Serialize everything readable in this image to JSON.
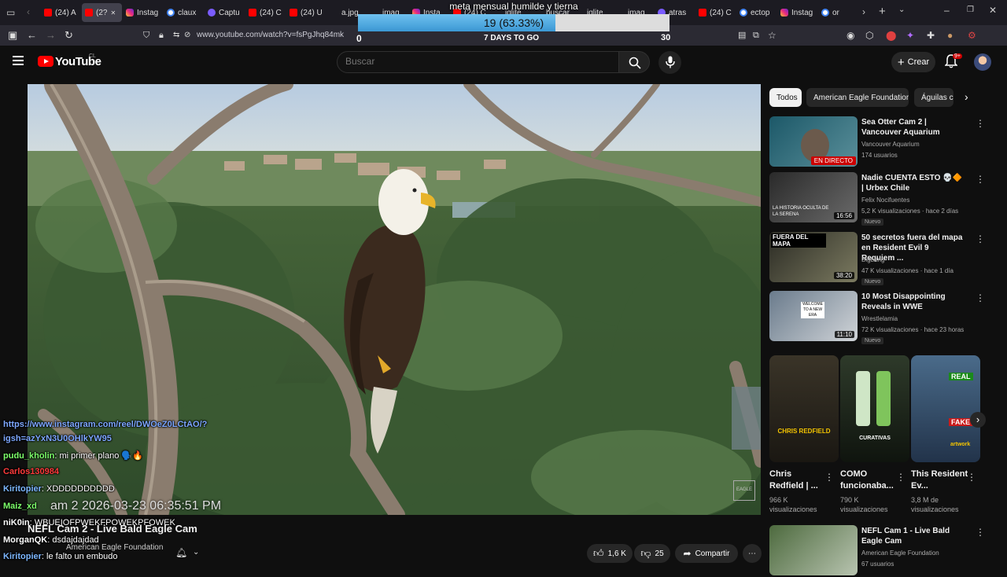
{
  "browser": {
    "tabs": [
      {
        "label": "(24) A",
        "icon": "youtube-favicon"
      },
      {
        "label": "(2?",
        "icon": "youtube-favicon",
        "active": true
      },
      {
        "label": "Instag",
        "icon": "instagram-favicon"
      },
      {
        "label": "claux",
        "icon": "google-favicon"
      },
      {
        "label": "Captu",
        "icon": "pen-favicon"
      },
      {
        "label": "(24) C",
        "icon": "youtube-favicon"
      },
      {
        "label": "(24) U",
        "icon": "youtube-favicon"
      },
      {
        "label": "a.jpg",
        "icon": "image-favicon"
      },
      {
        "label": "imag",
        "icon": "image-favicon"
      },
      {
        "label": "Insta",
        "icon": "instagram-favicon"
      },
      {
        "label": "(24) C",
        "icon": "youtube-favicon"
      },
      {
        "label": "iglite",
        "icon": "image-favicon"
      },
      {
        "label": "buscar",
        "icon": "image-favicon"
      },
      {
        "label": "iglite",
        "icon": "image-favicon"
      },
      {
        "label": "imag",
        "icon": "image-favicon"
      },
      {
        "label": "atras",
        "icon": "pen-favicon"
      },
      {
        "label": "(24) C",
        "icon": "youtube-favicon"
      },
      {
        "label": "ectop",
        "icon": "google-favicon"
      },
      {
        "label": "Instag",
        "icon": "instagram-favicon"
      },
      {
        "label": "or",
        "icon": "google-favicon"
      }
    ],
    "url": "www.youtube.com/watch?v=fsPgJhq84mk"
  },
  "goal": {
    "title": "meta mensual humilde y tierna",
    "progress_label": "19 (63.33%)",
    "progress": 0.6333,
    "min": "0",
    "max": "30",
    "days_left": "7 DAYS TO GO"
  },
  "youtube": {
    "logo_text": "YouTube",
    "country": "CL",
    "search_placeholder": "Buscar",
    "create_label": "Crear",
    "notif_count": "9+"
  },
  "chat": [
    {
      "user": "https://www.instagram.com/reel/DWOeZ0LCtAO/?",
      "text": "",
      "color": "#7da7ff"
    },
    {
      "user": "igsh=azYxN3U0OHlkYW95",
      "text": "",
      "color": "#7da7ff"
    },
    {
      "user": "pudu_kholin",
      "text": ": mi primer plano 🗣️🔥",
      "color": "#7cff6a"
    },
    {
      "user": "Carlos130984",
      "text": "",
      "color": "#ff3b3b"
    },
    {
      "user": "Kiritopier",
      "text": ": XDDDDDDDDDD",
      "color": "#7db7ff"
    },
    {
      "user": "Maiz_xd",
      "text": "",
      "color": "#7cff6a"
    },
    {
      "user": "niK0in",
      "text": ": WBUEIOFPWEKFPOWEKPFOWEK",
      "color": "#ffffff"
    },
    {
      "user": "MorganQK",
      "text": ": dsdajdajdad",
      "color": "#ffffff"
    },
    {
      "user": "Kiritopier",
      "text": ": le falto un embudo",
      "color": "#7db7ff"
    }
  ],
  "stream_stamp": "am 2 2026-03-23 06:35:51 PM",
  "video": {
    "title": "NEFL Cam 2 - Live Bald Eagle Cam",
    "channel": "American Eagle Foundation",
    "likes": "1,6 K",
    "dislikes": "25",
    "share_label": "Compartir",
    "watermark": "EAGLE"
  },
  "sidebar": {
    "chips": [
      {
        "label": "Todos",
        "active": true
      },
      {
        "label": "American Eagle Foundation"
      },
      {
        "label": "Águilas ca"
      }
    ],
    "videos": [
      {
        "title": "Sea Otter Cam 2 | Vancouver Aquarium",
        "channel": "Vancouver Aquarium",
        "views": "174 usuarios",
        "badge": "",
        "duration": "",
        "live": "EN DIRECTO"
      },
      {
        "title": "Nadie CUENTA ESTO 💀🔶 | Urbex Chile",
        "channel": "Felix Nocifuentes",
        "views": "5,2 K visualizaciones · hace 2 días",
        "badge": "Nuevo",
        "duration": "16:56",
        "live": "",
        "thumb_text": "LA HISTORIA OCULTA DE LA SERENA"
      },
      {
        "title": "50 secretos fuera del mapa en Resident Evil 9 Requiem ...",
        "channel": "Bigbang",
        "views": "47 K visualizaciones · hace 1 día",
        "badge": "Nuevo",
        "duration": "38:20",
        "live": "",
        "thumb_text": "FUERA DEL MAPA"
      },
      {
        "title": "10 Most Disappointing Reveals in WWE",
        "channel": "Wrestlelamia",
        "views": "72 K visualizaciones · hace 23 horas",
        "badge": "Nuevo",
        "duration": "11:10",
        "live": "",
        "thumb_text": "WELCOME TO A NEW ERA"
      }
    ],
    "shorts": [
      {
        "title": "Chris Redfield | ...",
        "views": "966 K visualizaciones",
        "thumb_text": "CHRIS REDFIELD"
      },
      {
        "title": "COMO funcionaba...",
        "views": "790 K visualizaciones",
        "thumb_text": "CURATIVAS"
      },
      {
        "title": "This Resident Ev...",
        "views": "3,8 M de visualizaciones",
        "thumb_text": "REAL",
        "thumb_text2": "FAKE",
        "thumb_text3": "artwork"
      }
    ],
    "last_video": {
      "title": "NEFL Cam 1 - Live Bald Eagle Cam",
      "channel": "American Eagle Foundation",
      "views": "67 usuarios"
    }
  }
}
